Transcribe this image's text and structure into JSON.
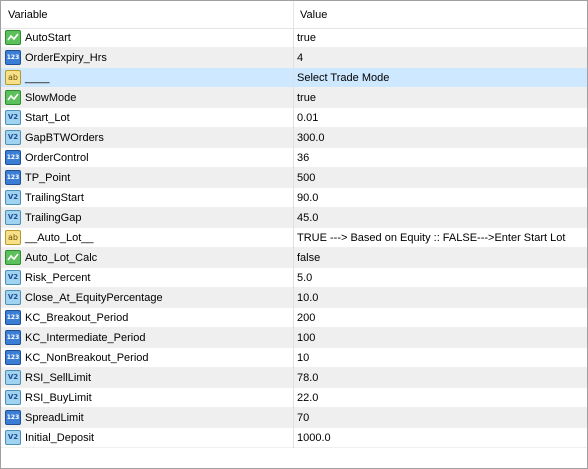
{
  "header": {
    "variable": "Variable",
    "value": "Value"
  },
  "rows": [
    {
      "name": "AutoStart",
      "value": "true",
      "type": "bool"
    },
    {
      "name": "OrderExpiry_Hrs",
      "value": "4",
      "type": "int"
    },
    {
      "name": "____",
      "value": "Select Trade Mode",
      "type": "string",
      "selected": true
    },
    {
      "name": "SlowMode",
      "value": "true",
      "type": "bool"
    },
    {
      "name": "Start_Lot",
      "value": "0.01",
      "type": "double"
    },
    {
      "name": "GapBTWOrders",
      "value": "300.0",
      "type": "double"
    },
    {
      "name": "OrderControl",
      "value": "36",
      "type": "int"
    },
    {
      "name": "TP_Point",
      "value": "500",
      "type": "int"
    },
    {
      "name": "TrailingStart",
      "value": "90.0",
      "type": "double"
    },
    {
      "name": "TrailingGap",
      "value": "45.0",
      "type": "double"
    },
    {
      "name": "__Auto_Lot__",
      "value": "TRUE ---> Based on Equity ::  FALSE--->Enter Start Lot",
      "type": "string"
    },
    {
      "name": "Auto_Lot_Calc",
      "value": "false",
      "type": "bool"
    },
    {
      "name": "Risk_Percent",
      "value": "5.0",
      "type": "double"
    },
    {
      "name": "Close_At_EquityPercentage",
      "value": "10.0",
      "type": "double"
    },
    {
      "name": "KC_Breakout_Period",
      "value": "200",
      "type": "int"
    },
    {
      "name": "KC_Intermediate_Period",
      "value": "100",
      "type": "int"
    },
    {
      "name": "KC_NonBreakout_Period",
      "value": "10",
      "type": "int"
    },
    {
      "name": "RSI_SellLimit",
      "value": "78.0",
      "type": "double"
    },
    {
      "name": "RSI_BuyLimit",
      "value": "22.0",
      "type": "double"
    },
    {
      "name": "SpreadLimit",
      "value": "70",
      "type": "int"
    },
    {
      "name": "Initial_Deposit",
      "value": "1000.0",
      "type": "double"
    }
  ],
  "icons": {
    "bool": {
      "name": "bool-icon",
      "label": ""
    },
    "int": {
      "name": "int-icon",
      "label": "123"
    },
    "double": {
      "name": "double-icon",
      "label": "V2"
    },
    "string": {
      "name": "string-icon",
      "label": "ab"
    }
  }
}
